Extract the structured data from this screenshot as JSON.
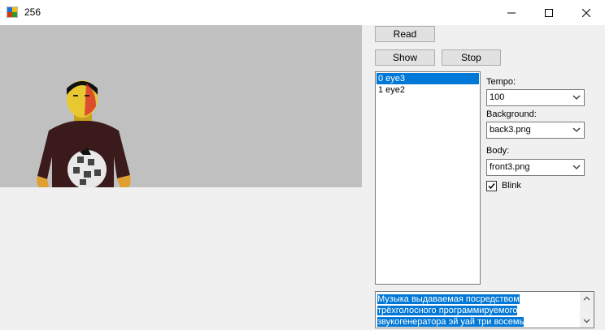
{
  "window": {
    "title": "256",
    "icon": "app-icon"
  },
  "controls": {
    "minimize_icon": "minimize-icon",
    "maximize_icon": "maximize-icon",
    "close_icon": "close-icon"
  },
  "buttons": {
    "read": "Read",
    "show": "Show",
    "stop": "Stop"
  },
  "list": {
    "items": [
      "0 eye3",
      "1 eye2"
    ],
    "selected_index": 0
  },
  "tempo": {
    "label": "Tempo:",
    "value": "100"
  },
  "background": {
    "label": "Background:",
    "value": "back3.png"
  },
  "body_select": {
    "label": "Body:",
    "value": "front3.png"
  },
  "blink": {
    "label": "Blink",
    "checked": true
  },
  "textbox": {
    "lines": [
      "Музыка выдаваемая посредством",
      "трёхголосного программируемого",
      "звукогенератора эй уай три восемь"
    ]
  },
  "colors": {
    "accent": "#0078d7",
    "preview_bg": "#c0c0c0",
    "window_bg": "#f0f0f0"
  }
}
